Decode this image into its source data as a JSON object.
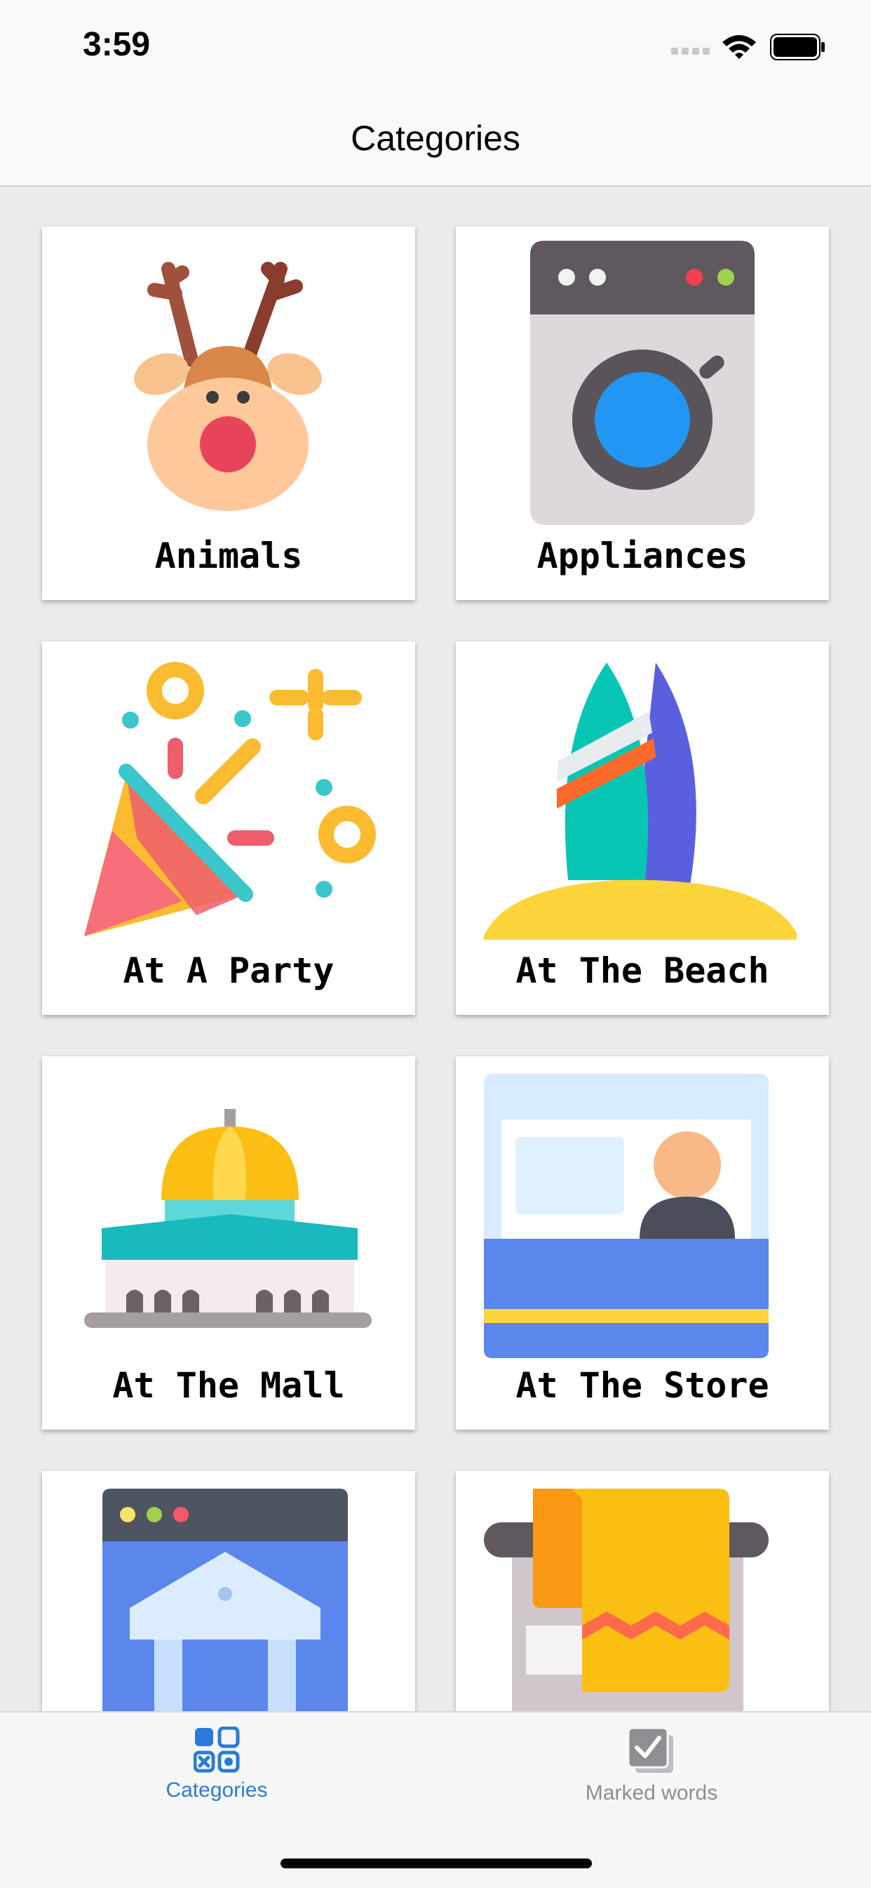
{
  "status": {
    "time": "3:59"
  },
  "nav": {
    "title": "Categories"
  },
  "categories": [
    {
      "label": "Animals",
      "icon": "reindeer-icon"
    },
    {
      "label": "Appliances",
      "icon": "washing-machine-icon"
    },
    {
      "label": "At A Party",
      "icon": "party-popper-icon"
    },
    {
      "label": "At The Beach",
      "icon": "surfboard-icon"
    },
    {
      "label": "At The Mall",
      "icon": "mall-building-icon"
    },
    {
      "label": "At The Store",
      "icon": "store-counter-icon"
    },
    {
      "label": "",
      "icon": "bank-website-icon"
    },
    {
      "label": "",
      "icon": "towel-rack-icon"
    }
  ],
  "tabbar": {
    "tabs": [
      {
        "label": "Categories",
        "active": true,
        "icon": "categories-grid-icon"
      },
      {
        "label": "Marked words",
        "active": false,
        "icon": "checkbox-stack-icon"
      }
    ]
  },
  "colors": {
    "accent": "#2a7bd8",
    "inactive": "#8e8e93",
    "background": "#ebebed"
  }
}
